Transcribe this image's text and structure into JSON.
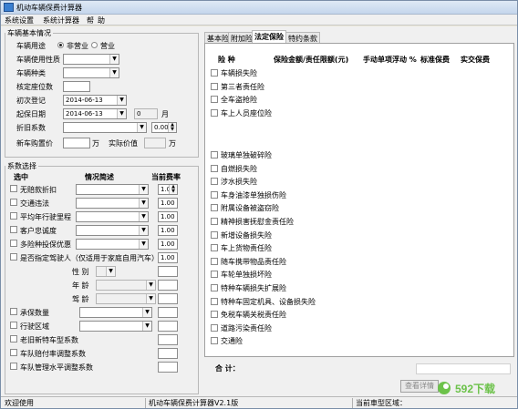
{
  "window": {
    "title": "机动车辆保费计算器"
  },
  "menu": [
    "系统设置",
    "系统计算器",
    "帮",
    "助"
  ],
  "vehicle": {
    "legend": "车辆基本情况",
    "use_label": "车辆用途",
    "radio_commercial": "非营业",
    "radio_noncommercial": "营业",
    "nature_label": "车辆使用性质",
    "type_label": "车辆种类",
    "seats_label": "核定座位数",
    "first_reg_label": "初次登记",
    "first_reg_value": "2014-06-13",
    "start_label": "起保日期",
    "start_value": "2014-06-13",
    "spin_value": "0",
    "month_unit": "月",
    "discount_label": "折旧系数",
    "discount_value": "0.00",
    "price_label": "新车购置价",
    "price_unit": "万",
    "actual_label": "实际价值",
    "actual_unit": "万"
  },
  "coef": {
    "legend": "系数选择",
    "h_select": "选中",
    "h_desc": "情况简述",
    "h_rate": "当前费率",
    "items": [
      "无赔款折扣",
      "交通违法",
      "平均年行驶里程",
      "客户忠诚度",
      "多险种投保优惠",
      "是否指定驾驶人（仅适用于家庭自用汽车）"
    ],
    "rates": [
      "1.00",
      "1.00",
      "1.00",
      "1.00",
      "1.00"
    ],
    "driver_rate": "1.00",
    "sub_labels": [
      "性  别",
      "年  龄",
      "驾  龄"
    ],
    "items2": [
      "承保数量",
      "行驶区域",
      "老旧新特车型系数",
      "车队赔付率调整系数",
      "车队管理水平调整系数"
    ]
  },
  "tabs": [
    "基本险",
    "附加险",
    "法定保险",
    "特约条款"
  ],
  "table": {
    "h_kind": "险  种",
    "h_amount": "保险金额/责任限额(元)",
    "h_float": "手动单项浮动 %",
    "h_std": "标准保费",
    "h_real": "实交保费",
    "base": [
      "车辆损失险",
      "第三者责任险",
      "全车盗抢险",
      "车上人员座位险"
    ],
    "addon": [
      "玻璃单独破碎险",
      "自燃损失险",
      "涉水损失险",
      "车身油漆单独损伤险",
      "附属设备被盗窃险",
      "精神损害抚慰金责任险",
      "新增设备损失险",
      "车上货物责任险",
      "随车携带物品责任险",
      "车轮单独损坏险",
      "特种车辆损失扩展险",
      "特种车固定机具、设备损失险",
      "免税车辆关税责任险",
      "道路污染责任险",
      "交通险"
    ],
    "total_label": "合    计："
  },
  "buttons": {
    "detail": "查看详情"
  },
  "status": {
    "left": "欢迎使用",
    "mid": "机动车辆保费计算器V2.1版",
    "right": "当前車型区域："
  },
  "watermark": "592下载"
}
